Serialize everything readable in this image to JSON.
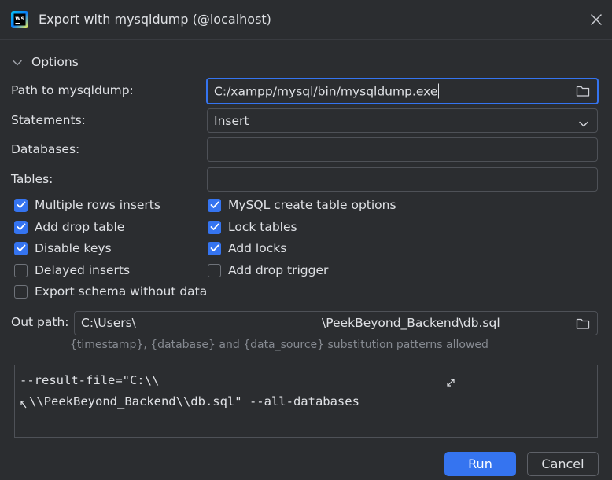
{
  "window": {
    "title": "Export with mysqldump (@localhost)",
    "app_icon_text": "WS"
  },
  "options": {
    "section_label": "Options",
    "path_label": "Path to mysqldump:",
    "path_value": "C:/xampp/mysql/bin/mysqldump.exe",
    "statements_label": "Statements:",
    "statements_value": "Insert",
    "databases_label": "Databases:",
    "databases_value": "",
    "tables_label": "Tables:",
    "tables_value": ""
  },
  "checkboxes": {
    "multiple_rows_inserts": {
      "label": "Multiple rows inserts",
      "checked": true
    },
    "mysql_create_table_options": {
      "label": "MySQL create table options",
      "checked": true
    },
    "add_drop_table": {
      "label": "Add drop table",
      "checked": true
    },
    "lock_tables": {
      "label": "Lock tables",
      "checked": true
    },
    "disable_keys": {
      "label": "Disable keys",
      "checked": true
    },
    "add_locks": {
      "label": "Add locks",
      "checked": true
    },
    "delayed_inserts": {
      "label": "Delayed inserts",
      "checked": false
    },
    "add_drop_trigger": {
      "label": "Add drop trigger",
      "checked": false
    },
    "export_schema_without_data": {
      "label": "Export schema without data",
      "checked": false
    }
  },
  "out_path": {
    "label": "Out path:",
    "value_part1": "C:\\Users\\",
    "value_part2": "\\PeekBeyond_Backend\\db.sql",
    "hint": "{timestamp}, {database} and {data_source} substitution patterns allowed"
  },
  "preview": {
    "line1": "--result-file=\"C:\\\\",
    "line2": "\\\\PeekBeyond_Backend\\\\db.sql\" --all-databases"
  },
  "buttons": {
    "run": "Run",
    "cancel": "Cancel"
  },
  "colors": {
    "background": "#2b2d30",
    "accent": "#3574f0",
    "border": "#4e5157",
    "text": "#dfe1e5",
    "hint": "#868a91"
  }
}
